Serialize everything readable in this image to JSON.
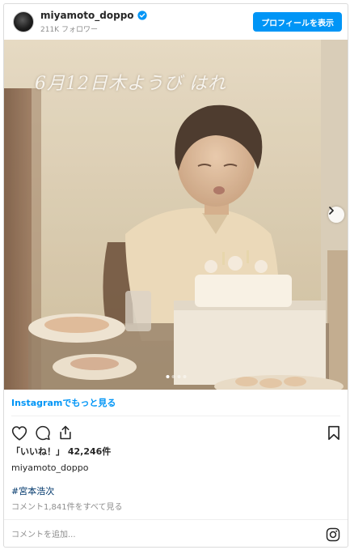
{
  "header": {
    "username": "miyamoto_doppo",
    "followers": "211K フォロワー",
    "profile_button": "プロフィールを表示"
  },
  "photo": {
    "overlay_text": "6月12日木ようび はれ",
    "carousel_index": 1,
    "carousel_total": 4
  },
  "more_link": "Instagramでもっと見る",
  "likes_text": "「いいね！」 42,246件",
  "caption": {
    "author": "miyamoto_doppo",
    "hashtag": "#宮本浩次"
  },
  "comments_link": "コメント1,841件をすべて見る",
  "comment_input": {
    "placeholder": "コメントを追加..."
  },
  "colors": {
    "accent": "#0095f6",
    "hashtag": "#00376b",
    "muted": "#8e8e8e"
  },
  "icons": [
    "verified-badge-icon",
    "chevron-right-icon",
    "heart-icon",
    "comment-icon",
    "share-icon",
    "bookmark-icon",
    "instagram-logo-icon"
  ]
}
